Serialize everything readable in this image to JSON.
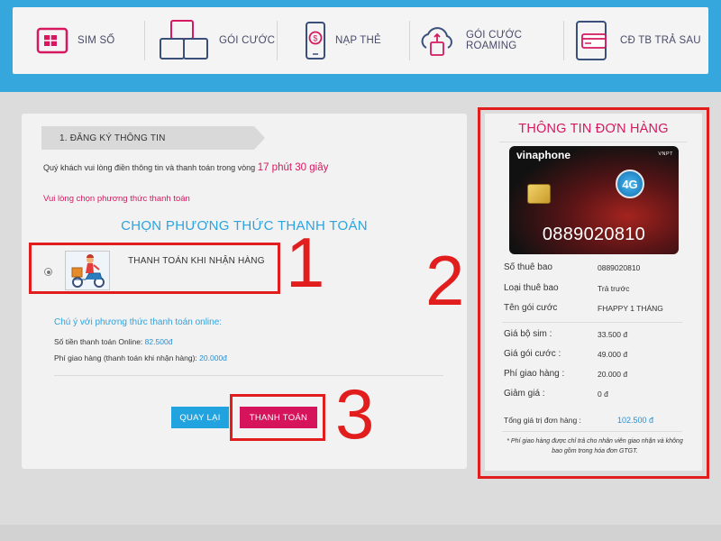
{
  "nav": {
    "items": [
      {
        "label": "SIM SỐ",
        "icon": "sim-card-icon"
      },
      {
        "label": "GÓI CƯỚC",
        "icon": "package-boxes-icon"
      },
      {
        "label": "NẠP THẺ",
        "icon": "mobile-topup-icon"
      },
      {
        "label": "GÓI CƯỚC ROAMING",
        "icon": "cloud-roaming-icon"
      },
      {
        "label": "CĐ TB TRẢ SAU",
        "icon": "postpaid-card-icon"
      }
    ]
  },
  "registration": {
    "step_label": "1. ĐĂNG KÝ THÔNG TIN",
    "timer_text": "Quý khách vui lòng điền thông tin và thanh toán trong vòng",
    "timer_value": "17 phút 30 giây",
    "choose_note": "Vui lòng chọn phương thức thanh toán",
    "method_title": "CHỌN PHƯƠNG THỨC THANH TOÁN",
    "method_option_label": "THANH TOÁN KHI NHẬN HÀNG",
    "online_title": "Chú ý với phương thức thanh toán online:",
    "online_amount_label": "Số tiền thanh toán Online:",
    "online_amount_value": "82.500đ",
    "shipping_label": "Phí giao hàng (thanh toán khi nhận hàng):",
    "shipping_value": "20.000đ",
    "back_button": "QUAY LẠI",
    "pay_button": "THANH TOÁN"
  },
  "order": {
    "title": "THÔNG TIN ĐƠN HÀNG",
    "card_brand": "vinaphone",
    "card_vnpt": "VNPT",
    "card_badge": "4G",
    "card_number": "0889020810",
    "rows": [
      {
        "k": "Số thuê bao",
        "v": "0889020810"
      },
      {
        "k": "Loại thuê bao",
        "v": "Trả trước"
      },
      {
        "k": "Tên gói cước",
        "v": "FHAPPY 1 THÁNG"
      }
    ],
    "prices": [
      {
        "k": "Giá bộ sim :",
        "v": "33.500 đ"
      },
      {
        "k": "Giá gói cước :",
        "v": "49.000 đ"
      },
      {
        "k": "Phí giao hàng :",
        "v": "20.000 đ"
      },
      {
        "k": "Giảm giá :",
        "v": "0 đ"
      }
    ],
    "total_label": "Tổng giá trị đơn hàng :",
    "total_value": "102.500 đ",
    "footnote": "* Phí giao hàng được chỉ trả cho nhân viên giao nhận và không bao gồm trong hóa đơn GTGT."
  },
  "callouts": {
    "one": "1",
    "two": "2",
    "three": "3"
  },
  "colors": {
    "accent_blue": "#35a7dc",
    "accent_pink": "#d5145c",
    "callout_red": "#e11d1d"
  }
}
